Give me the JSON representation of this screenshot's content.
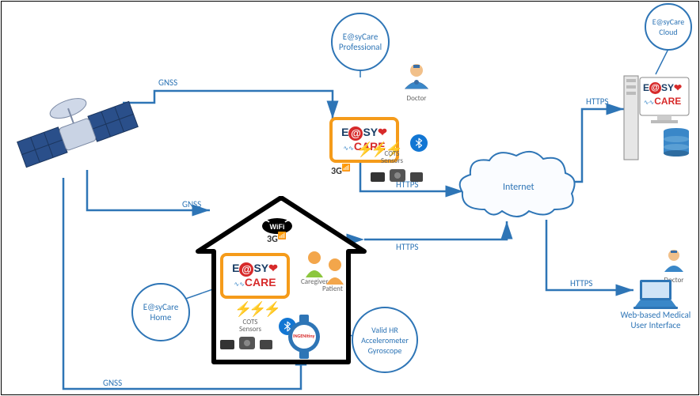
{
  "satellite": {
    "name": "Satellite"
  },
  "connections": {
    "gnss1": "GNSS",
    "gnss2": "GNSS",
    "gnss3": "GNSS",
    "https_pro": "HTTPS",
    "https_home": "HTTPS",
    "https_server": "HTTPS",
    "https_web": "HTTPS"
  },
  "professional": {
    "title": "E@syCare Professional",
    "doctor_label": "Doctor",
    "network": "3G",
    "bluetooth": "Bluetooth",
    "sensors_label": "COTS Sensors"
  },
  "home": {
    "title": "E@syCare Home",
    "wifi": "WiFi",
    "network": "3G",
    "bluetooth": "Bluetooth",
    "sensors_label": "COTS Sensors",
    "caregiver": "Caregiver",
    "patient": "Patient",
    "watch_brand": "INGENItiny"
  },
  "watch_bubble": {
    "text": "Valid HR Accelerometer Gyroscope"
  },
  "internet": {
    "label": "Internet"
  },
  "cloud": {
    "title": "E@syCare Cloud"
  },
  "webui": {
    "title": "Web-based Medical User Interface",
    "doctor_label": "Doctor"
  },
  "easy_logo": {
    "line1_e": "E",
    "line1_at": "@",
    "line1_sy": "SY",
    "line1_heart": "❤",
    "ecg": "∿∿",
    "line2": "CARE"
  },
  "colors": {
    "accent": "#2e75b6",
    "orange": "#f59b1a",
    "red": "#d72a2a",
    "navy": "#1b3f66"
  }
}
